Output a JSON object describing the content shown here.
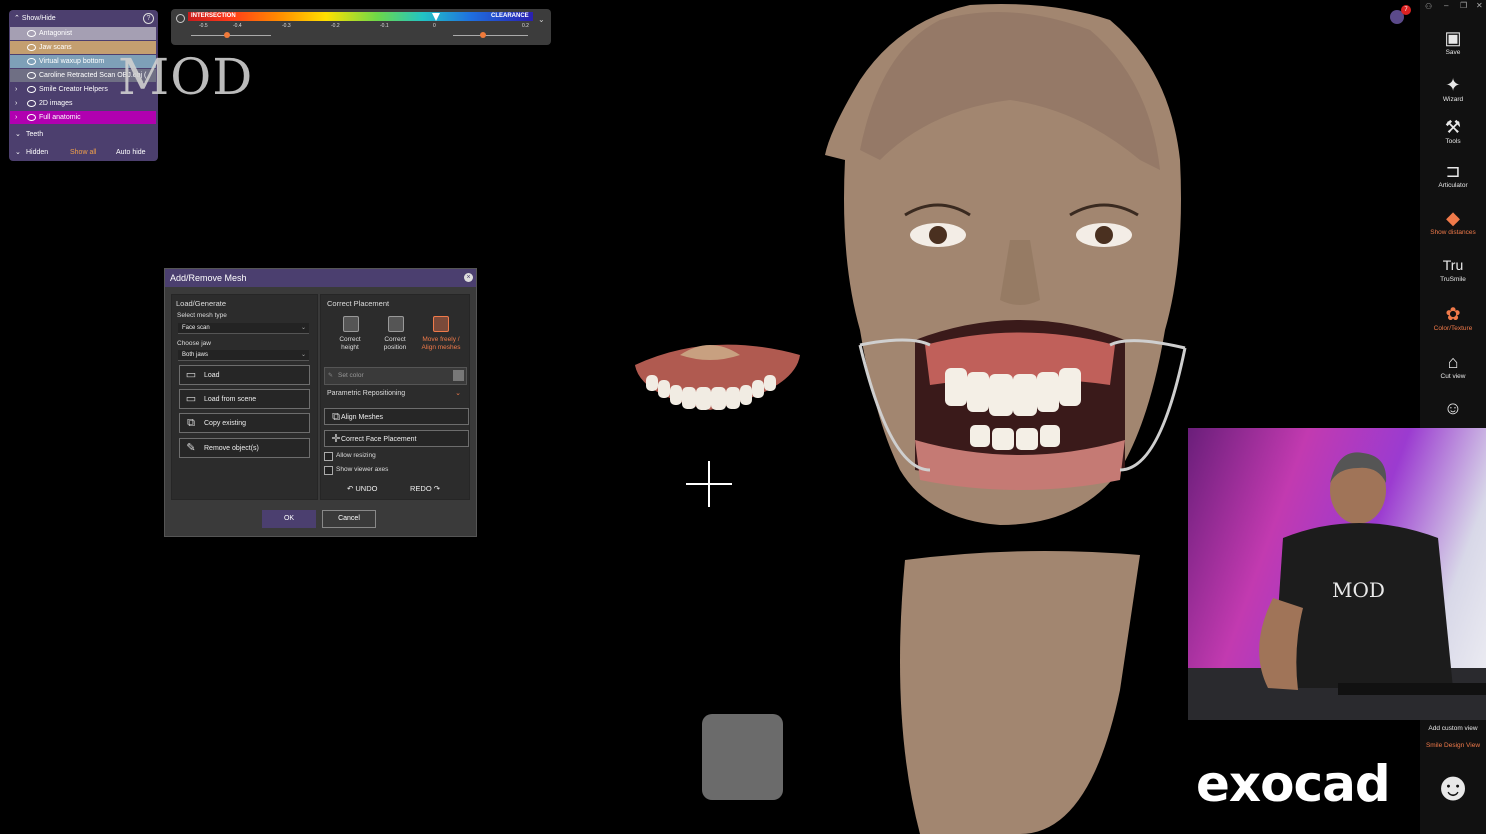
{
  "show_hide": {
    "title": "Show/Hide",
    "items": [
      {
        "label": "Antagonist",
        "bg": "#a59fb3"
      },
      {
        "label": "Jaw scans",
        "bg": "#c49f70"
      },
      {
        "label": "Virtual waxup bottom",
        "bg": "#7ea0b8"
      },
      {
        "label": "Caroline Retracted Scan OBJ.obj (",
        "bg": "#6f6f84"
      }
    ],
    "groups": [
      {
        "label": "Smile Creator Helpers",
        "bg": "#4c3f6e"
      },
      {
        "label": "2D images",
        "bg": "#4c3f6e"
      },
      {
        "label": "Full anatomic",
        "bg": "#b100b0"
      }
    ],
    "teeth_label": "Teeth",
    "hidden_label": "Hidden",
    "show_all": "Show all",
    "auto_hide": "Auto hide"
  },
  "watermark": "MOD",
  "colorbar": {
    "left_label": "INTERSECTION",
    "right_label": "CLEARANCE",
    "ticks": [
      "-0.5",
      "-0.4",
      "-0.3",
      "-0.2",
      "-0.1",
      "0",
      "0.2"
    ],
    "left_slider_value": -0.4,
    "right_slider_value": 0.1
  },
  "dialog": {
    "title": "Add/Remove Mesh",
    "load_generate": "Load/Generate",
    "select_mesh_type_label": "Select mesh type",
    "mesh_type_value": "Face scan",
    "choose_jaw_label": "Choose jaw",
    "jaw_value": "Both jaws",
    "buttons": [
      "Load",
      "Load from scene",
      "Copy existing",
      "Remove object(s)"
    ],
    "correct_placement": "Correct Placement",
    "placement_opts": [
      {
        "line1": "Correct",
        "line2": "height"
      },
      {
        "line1": "Correct",
        "line2": "position"
      },
      {
        "line1": "Move freely /",
        "line2": "Align meshes"
      }
    ],
    "set_color": "Set color",
    "parametric": "Parametric Repositioning",
    "align_meshes": "Align Meshes",
    "correct_face": "Correct Face Placement",
    "allow_resizing": "Allow resizing",
    "show_axes": "Show viewer axes",
    "undo": "UNDO",
    "redo": "REDO",
    "ok": "OK",
    "cancel": "Cancel"
  },
  "toolbar": [
    {
      "label": "Save",
      "icon": "save-icon"
    },
    {
      "label": "Wizard",
      "icon": "wizard-icon"
    },
    {
      "label": "Tools",
      "icon": "tools-icon"
    },
    {
      "label": "Articulator",
      "icon": "articulator-icon"
    },
    {
      "label": "Show distances",
      "icon": "distances-icon",
      "accent": "#f07a4a"
    },
    {
      "label": "TruSmile",
      "icon": "trusmile-icon"
    },
    {
      "label": "Color/Texture",
      "icon": "palette-icon",
      "accent": "#f07a4a"
    },
    {
      "label": "Cut view",
      "icon": "cut-view-icon"
    },
    {
      "label": "Add custom view",
      "icon": ""
    },
    {
      "label": "Smile Design View",
      "icon": "",
      "accent": "#f07a4a"
    }
  ],
  "notification_count": "7",
  "brand": "exocad",
  "webcam_shirt": "MOD"
}
